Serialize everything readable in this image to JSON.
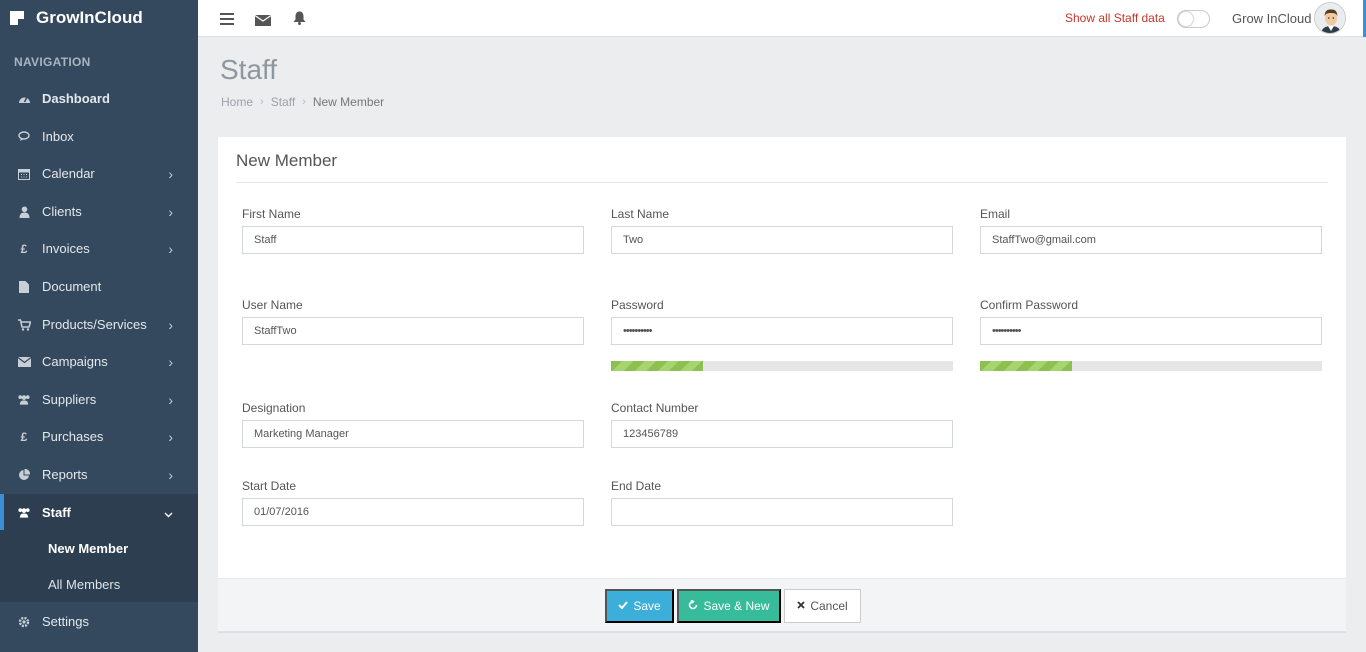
{
  "app": {
    "brand": "GrowInCloud"
  },
  "sidebar": {
    "heading": "NAVIGATION",
    "items": [
      {
        "label": "Dashboard",
        "icon": "dashboard-icon",
        "bold": true
      },
      {
        "label": "Inbox",
        "icon": "chat-icon"
      },
      {
        "label": "Calendar",
        "icon": "calendar-icon",
        "chevron": true
      },
      {
        "label": "Clients",
        "icon": "user-icon",
        "chevron": true
      },
      {
        "label": "Invoices",
        "icon": "pound-icon",
        "chevron": true
      },
      {
        "label": "Document",
        "icon": "document-icon"
      },
      {
        "label": "Products/Services",
        "icon": "cart-icon",
        "chevron": true
      },
      {
        "label": "Campaigns",
        "icon": "envelope-icon",
        "chevron": true
      },
      {
        "label": "Suppliers",
        "icon": "users-icon",
        "chevron": true
      },
      {
        "label": "Purchases",
        "icon": "pound-icon",
        "chevron": true
      },
      {
        "label": "Reports",
        "icon": "pie-chart-icon",
        "chevron": true
      },
      {
        "label": "Staff",
        "icon": "users-icon",
        "active": true
      },
      {
        "label": "Settings",
        "icon": "gear-icon"
      }
    ],
    "staff_sub": [
      "New Member",
      "All Members"
    ]
  },
  "topbar": {
    "toggle_label": "Show all Staff data",
    "toggle_on": false,
    "user_name": "Grow InCloud"
  },
  "page": {
    "title": "Staff",
    "breadcrumb": [
      "Home",
      "Staff",
      "New Member"
    ]
  },
  "form": {
    "title": "New Member",
    "fields": {
      "first_name": {
        "label": "First Name",
        "value": "Staff"
      },
      "last_name": {
        "label": "Last Name",
        "value": "Two"
      },
      "email": {
        "label": "Email",
        "value": "StaffTwo@gmail.com"
      },
      "user_name": {
        "label": "User Name",
        "value": "StaffTwo"
      },
      "password": {
        "label": "Password",
        "value": "••••••••••"
      },
      "confirm_password": {
        "label": "Confirm Password",
        "value": "••••••••••"
      },
      "designation": {
        "label": "Designation",
        "value": "Marketing Manager"
      },
      "contact_number": {
        "label": "Contact Number",
        "value": "123456789"
      },
      "start_date": {
        "label": "Start Date",
        "value": "01/07/2016"
      },
      "end_date": {
        "label": "End Date",
        "value": ""
      }
    },
    "password_strength": 0.27,
    "confirm_strength": 0.27,
    "buttons": {
      "save": "Save",
      "save_new": "Save & New",
      "cancel": "Cancel"
    }
  },
  "colors": {
    "sidebar": "#34495e",
    "accent": "#3b8fd6",
    "save": "#3bafda",
    "save_new": "#37bc9b",
    "strength": "#8cc152",
    "toggle_label": "#c0392b"
  }
}
